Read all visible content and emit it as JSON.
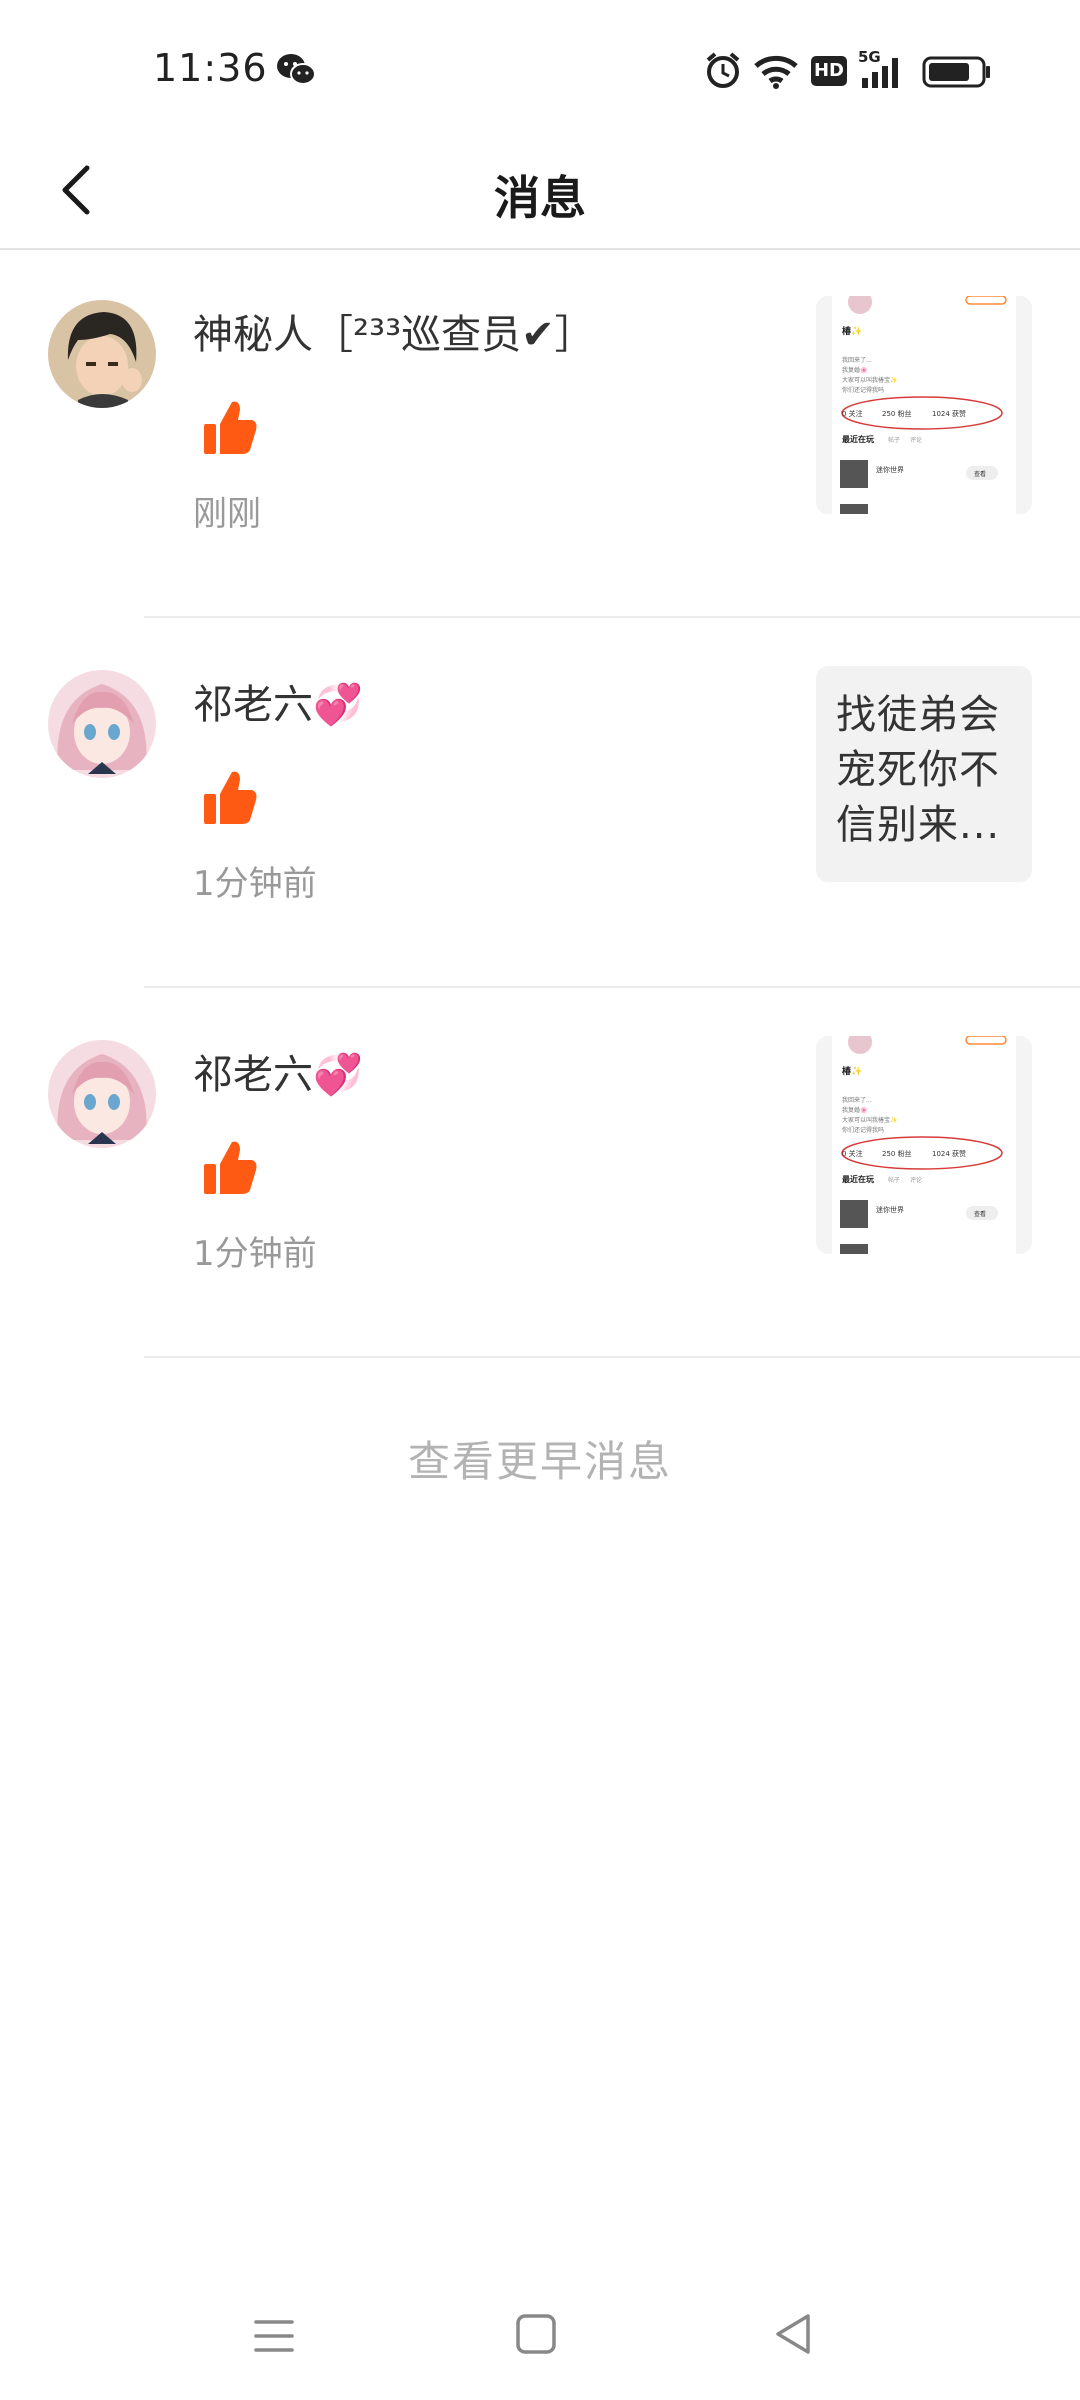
{
  "status_bar": {
    "time": "11:36",
    "icons": [
      "wechat-icon",
      "alarm-icon",
      "wifi-icon",
      "hd-badge",
      "signal-5g-icon",
      "battery-icon"
    ],
    "hd_label": "HD",
    "network_label": "5G",
    "battery_level": 0.8
  },
  "header": {
    "title": "消息",
    "back_icon": "chevron-left-icon"
  },
  "notifications": [
    {
      "user": "神秘人［²³³巡查员✔］",
      "action_icon": "thumbs-up-icon",
      "time": "刚刚",
      "preview_type": "screenshot",
      "preview": {
        "name": "椿✨",
        "line1": "我回来了...",
        "line2": "我复婚🌸",
        "line3": "大家可以叫我椿宝✨",
        "line4": "你们还记得我吗",
        "stats": [
          "0 关注",
          "250 粉丝",
          "1024 获赞"
        ],
        "tabs": [
          "最近在玩",
          "帖子",
          "评论"
        ],
        "game": "迷你世界",
        "button": "查看"
      }
    },
    {
      "user": "祁老六💞",
      "action_icon": "thumbs-up-icon",
      "time": "1分钟前",
      "preview_type": "text",
      "preview_lines": [
        "找徒弟会",
        "宠死你不",
        "信别来..."
      ]
    },
    {
      "user": "祁老六💞",
      "action_icon": "thumbs-up-icon",
      "time": "1分钟前",
      "preview_type": "screenshot",
      "preview": {
        "name": "椿✨",
        "line1": "我回来了...",
        "line2": "我复婚🌸",
        "line3": "大家可以叫我椿宝✨",
        "line4": "你们还记得我吗",
        "stats": [
          "0 关注",
          "250 粉丝",
          "1024 获赞"
        ],
        "tabs": [
          "最近在玩",
          "帖子",
          "评论"
        ],
        "game": "迷你世界",
        "button": "查看"
      }
    }
  ],
  "earlier_link": "查看更早消息",
  "nav_bar": {
    "icons": [
      "menu-icon",
      "home-icon",
      "back-triangle-icon"
    ]
  },
  "colors": {
    "like": "#ff5a14",
    "divider": "#ececec",
    "muted_text": "#999999",
    "earlier_text": "#b3b3b3"
  }
}
